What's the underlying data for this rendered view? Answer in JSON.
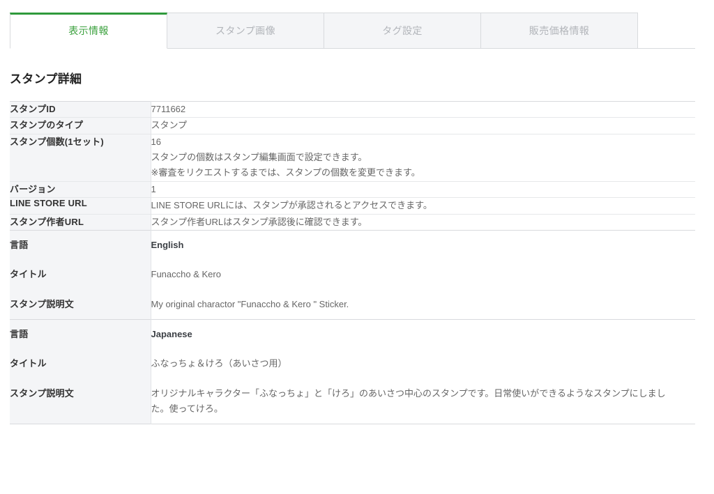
{
  "tabs": [
    {
      "label": "表示情報",
      "active": true
    },
    {
      "label": "スタンプ画像",
      "active": false
    },
    {
      "label": "タグ設定",
      "active": false
    },
    {
      "label": "販売価格情報",
      "active": false
    }
  ],
  "page": {
    "title": "スタンプ詳細"
  },
  "colors": {
    "accent_green": "#2f9a3c",
    "active_tab_text": "#3aa03c",
    "inactive_tab_text": "#b2b5ba",
    "label_bg": "#f4f5f7",
    "border": "#d8dadd"
  },
  "details": [
    {
      "label": "スタンプID",
      "lines": [
        "7711662"
      ]
    },
    {
      "label": "スタンプのタイプ",
      "lines": [
        "スタンプ"
      ]
    },
    {
      "label": "スタンプ個数(1セット)",
      "lines": [
        "16",
        "スタンプの個数はスタンプ編集画面で設定できます。",
        "※審査をリクエストするまでは、スタンプの個数を変更できます。"
      ]
    },
    {
      "label": "バージョン",
      "lines": [
        "1"
      ]
    },
    {
      "label": "LINE STORE URL",
      "lines": [
        "LINE STORE URLには、スタンプが承認されるとアクセスできます。"
      ]
    },
    {
      "label": "スタンプ作者URL",
      "lines": [
        "スタンプ作者URLはスタンプ承認後に確認できます。"
      ]
    }
  ],
  "languages": [
    {
      "lang_label": "言語",
      "lang_value": "English",
      "title_label": "タイトル",
      "title_value": "Funaccho & Kero",
      "desc_label": "スタンプ説明文",
      "desc_value": "My original charactor \"Funaccho & Kero \" Sticker."
    },
    {
      "lang_label": "言語",
      "lang_value": "Japanese",
      "title_label": "タイトル",
      "title_value": "ふなっちょ＆けろ（あいさつ用）",
      "desc_label": "スタンプ説明文",
      "desc_value": "オリジナルキャラクター「ふなっちょ」と「けろ」のあいさつ中心のスタンプです。日常使いができるようなスタンプにしました。使ってけろ。"
    }
  ]
}
